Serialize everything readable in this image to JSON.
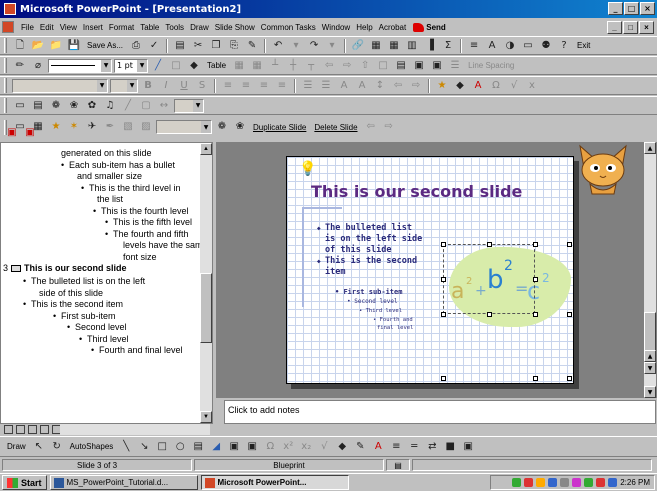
{
  "window": {
    "title": "Microsoft PowerPoint - [Presentation2]",
    "controls": [
      "_",
      "□",
      "×"
    ]
  },
  "menu": {
    "items": [
      "File",
      "Edit",
      "View",
      "Insert",
      "Format",
      "Table",
      "Tools",
      "Draw",
      "Slide Show",
      "Common Tasks",
      "Window",
      "Help",
      "Acrobat"
    ],
    "send": "Send",
    "doc_controls": [
      "_",
      "□",
      "×"
    ]
  },
  "toolbar": {
    "save_as": "Save As...",
    "exit": "Exit",
    "line_weight": "1 pt",
    "table": "Table",
    "line_spacing": "Line Spacing",
    "duplicate_slide": "Duplicate Slide",
    "delete_slide": "Delete Slide"
  },
  "outline": {
    "lines": [
      {
        "level": 2,
        "text": "generated on this slide",
        "bullet": ""
      },
      {
        "level": 2,
        "text": "Each sub-item has a bullet",
        "bullet": "•"
      },
      {
        "level": 2,
        "text": "and smaller size",
        "bullet": ""
      },
      {
        "level": 3,
        "text": "This is the third level in",
        "bullet": "•"
      },
      {
        "level": 3,
        "text": "the list",
        "bullet": ""
      },
      {
        "level": 4,
        "text": "This is the fourth level",
        "bullet": "•"
      },
      {
        "level": 5,
        "text": "This is the fifth level",
        "bullet": "•"
      },
      {
        "level": 5,
        "text": "The fourth and fifth",
        "bullet": "•"
      },
      {
        "level": 5,
        "text": "levels have the same",
        "bullet": ""
      },
      {
        "level": 5,
        "text": "font size",
        "bullet": ""
      },
      {
        "level": 0,
        "text": "This is our second slide",
        "bullet": "",
        "slide_number": "3",
        "is_title": true
      },
      {
        "level": 1,
        "text": "The bulleted list is on the left",
        "bullet": "•"
      },
      {
        "level": 1,
        "text": "side of this slide",
        "bullet": ""
      },
      {
        "level": 1,
        "text": "This is the second item",
        "bullet": "•"
      },
      {
        "level": 2,
        "text": "First sub-item",
        "bullet": "•"
      },
      {
        "level": 3,
        "text": "Second level",
        "bullet": "•"
      },
      {
        "level": 4,
        "text": "Third level",
        "bullet": "•"
      },
      {
        "level": 5,
        "text": "Fourth and final level",
        "bullet": "•"
      }
    ]
  },
  "slide": {
    "title": "This is our second slide",
    "bullets": [
      "The bulleted list",
      "is on the left side",
      "of this slide",
      "This is the second",
      "item"
    ],
    "sub_items": {
      "first": "First sub-item",
      "second": "Second level",
      "third": "Third level",
      "fourth": "Fourth and",
      "final": "final level"
    },
    "equation": {
      "a": "a",
      "b": "b",
      "c": "c",
      "exp": "2",
      "plus": "+",
      "eq": "="
    },
    "accent_color": "#5b2a82",
    "equation_bg": "#d8ecaa"
  },
  "notes": {
    "placeholder": "Click to add notes"
  },
  "drawbar": {
    "draw": "Draw",
    "autoshapes": "AutoShapes"
  },
  "status": {
    "slide": "Slide 3 of 3",
    "design": "Blueprint"
  },
  "taskbar": {
    "start": "Start",
    "task1": "MS_PowerPoint_Tutorial.d...",
    "task2": "Microsoft PowerPoint...",
    "clock": "2:26 PM"
  }
}
